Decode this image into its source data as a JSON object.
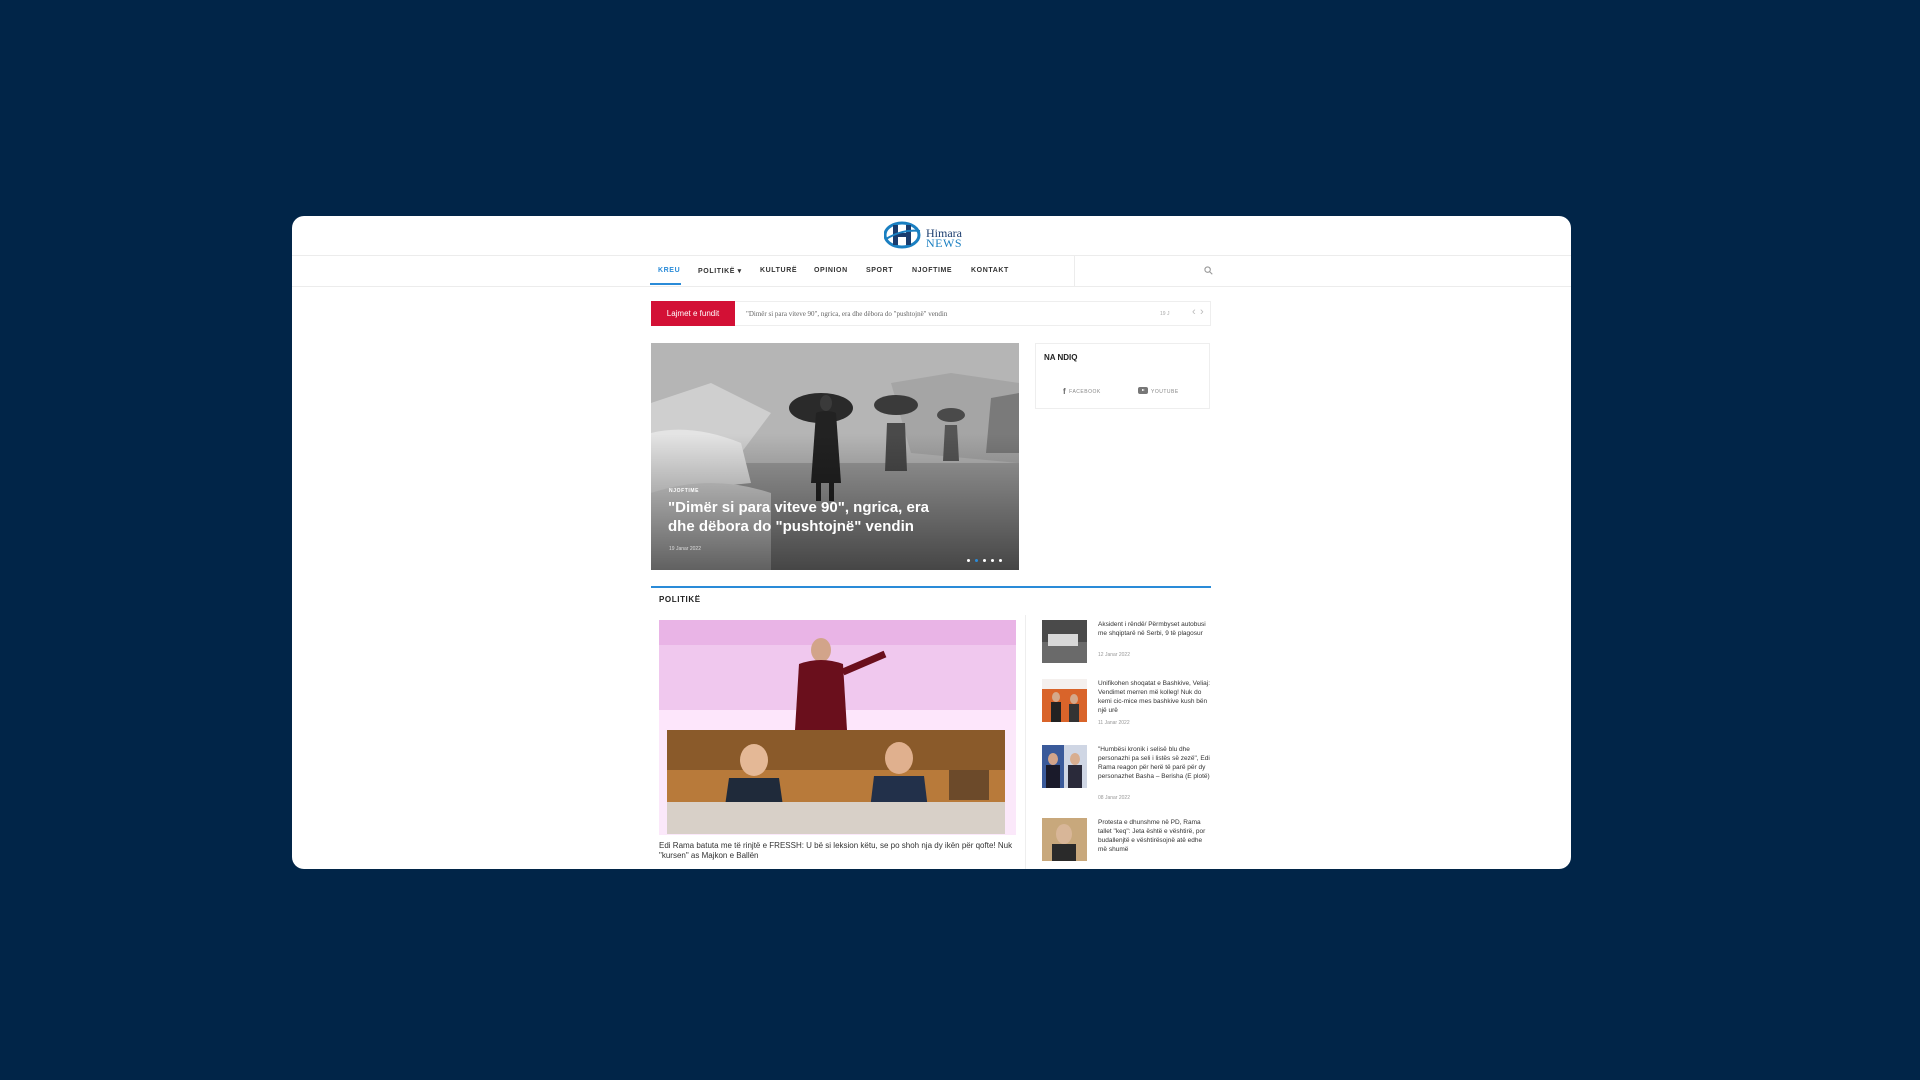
{
  "brand": {
    "name_line1": "Himara",
    "name_line2": "NEWS"
  },
  "nav": {
    "items": [
      {
        "label": "KREU"
      },
      {
        "label": "POLITIKË"
      },
      {
        "label": "KULTURË"
      },
      {
        "label": "OPINION"
      },
      {
        "label": "SPORT"
      },
      {
        "label": "NJOFTIME"
      },
      {
        "label": "KONTAKT"
      }
    ],
    "active_index": 0,
    "dropdown_caret": "▾"
  },
  "ticker": {
    "label": "Lajmet e fundit",
    "headline": "\"Dimër si para viteve 90\", ngrica, era dhe dëbora do \"pushtojnë\" vendin",
    "date": "19 J",
    "prev": "‹",
    "next": "›"
  },
  "hero": {
    "category": "NJOFTIME",
    "title": "\"Dimër si para viteve 90\", ngrica, era dhe dëbora do \"pushtojnë\" vendin",
    "date": "19 Janar 2022",
    "slide_count": 5,
    "active_slide": 1
  },
  "follow": {
    "title": "NA NDIQ",
    "facebook": "FACEBOOK",
    "youtube": "YOUTUBE"
  },
  "section": {
    "title": "POLITIKË",
    "main_caption": "Edi Rama batuta me të rinjtë e FRESSH: U bë si leksion këtu, se po shoh nja dy ikën për qofte! Nuk \"kursen\" as Majkon e Ballën",
    "side": [
      {
        "title": "Aksident i rëndë/ Përmbyset autobusi me shqiptarë në Serbi, 9 të plagosur",
        "date": "12 Janar 2022"
      },
      {
        "title": "Unifikohen shoqatat e Bashkive, Veliaj: Vendimet merren më kolleg! Nuk do kemi cic-mice mes bashkive kush bën një urë",
        "date": "11 Janar 2022"
      },
      {
        "title": "\"Humbësi kronik i selisë blu dhe personazhi pa seli i listës së zezë\", Edi Rama reagon për herë të parë për dy personazhet Basha – Berisha (E plotë)",
        "date": "08 Janar 2022"
      },
      {
        "title": "Protesta e dhunshme në PD, Rama tallet \"keq\": Jeta është e vështirë, por budallenjtë e vështirësojnë atë edhe më shumë",
        "date": ""
      }
    ]
  }
}
